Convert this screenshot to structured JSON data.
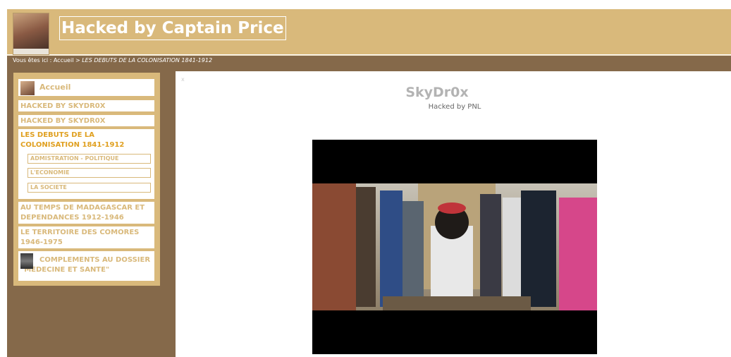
{
  "header": {
    "site_title": "Hacked by Captain Price"
  },
  "breadcrumb": {
    "prefix": "Vous êtes ici : ",
    "home": "Accueil",
    "separator": " > ",
    "current": "LES DEBUTS DE LA COLONISATION 1841-1912"
  },
  "menu": {
    "items": [
      {
        "label": "Accueil"
      },
      {
        "label": "HACKED BY SKYDR0X"
      },
      {
        "label": "HACKED BY SKYDR0X"
      },
      {
        "label": "LES DEBUTS DE LA COLONISATION 1841-1912",
        "children": [
          "ADMISTRATION - POLITIQUE",
          "L'ECONOMIE",
          "LA SOCIETE"
        ]
      },
      {
        "label": "AU TEMPS DE MADAGASCAR ET DEPENDANCES 1912-1946"
      },
      {
        "label": "LE TERRITOIRE DES COMORES 1946-1975"
      },
      {
        "label": "COMPLEMENTS AU DOSSIER \"MEDECINE ET SANTE\""
      }
    ]
  },
  "content": {
    "mark": "x",
    "title": "SkyDr0x",
    "subtitle": "Hacked by PNL"
  },
  "colors": {
    "header_bg": "#d9b97b",
    "sidebar_bg": "#85694a",
    "active_menu": "#e0a020"
  }
}
